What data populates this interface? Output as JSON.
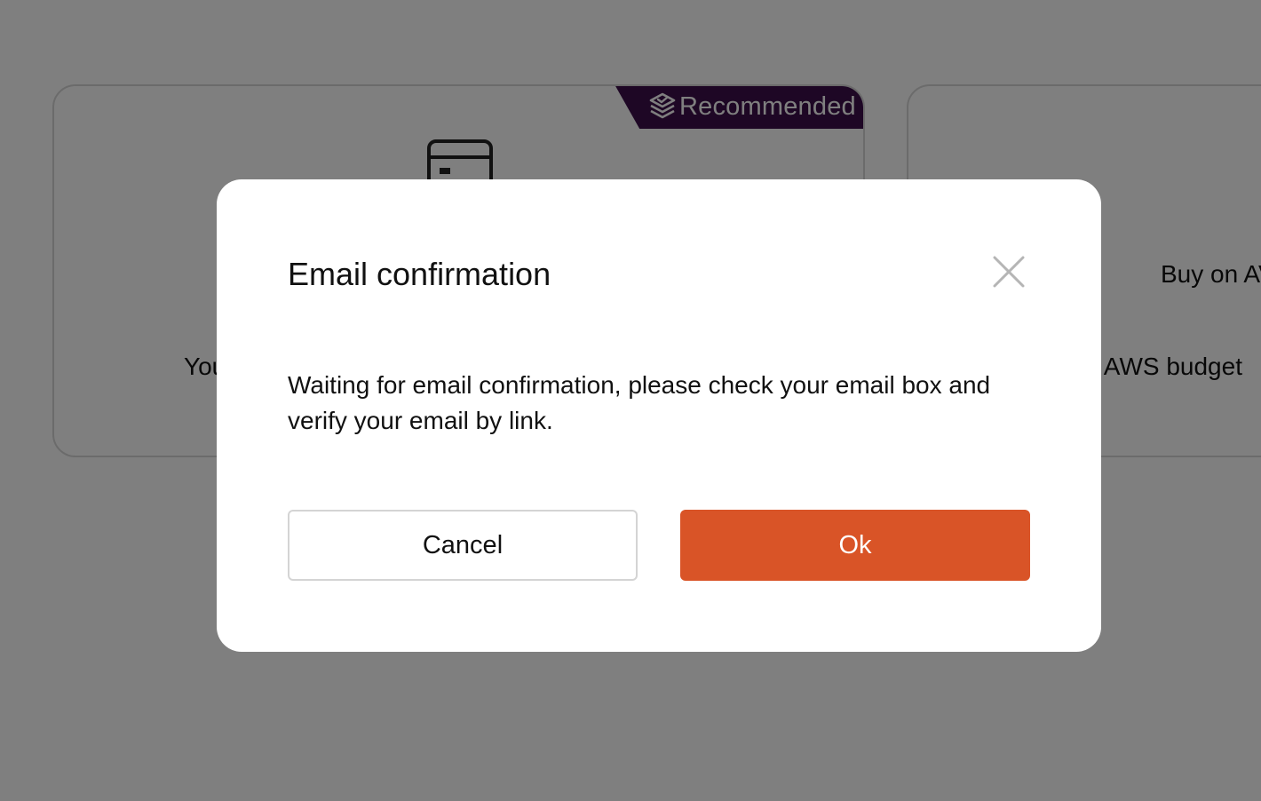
{
  "background": {
    "recommended_badge": "Recommended",
    "card_left_text": "You",
    "card_right_title": "Buy on AV",
    "card_right_text": "g AWS budget"
  },
  "modal": {
    "title": "Email confirmation",
    "message": "Waiting for email confirmation, please check your email box and verify your email by link.",
    "cancel_label": "Cancel",
    "ok_label": "Ok"
  },
  "colors": {
    "primary": "#d95427",
    "badge": "#3d0f4a",
    "overlay": "rgba(0,0,0,0.5)"
  },
  "icons": [
    "layers-check-icon",
    "credit-card-icon",
    "close-icon"
  ]
}
